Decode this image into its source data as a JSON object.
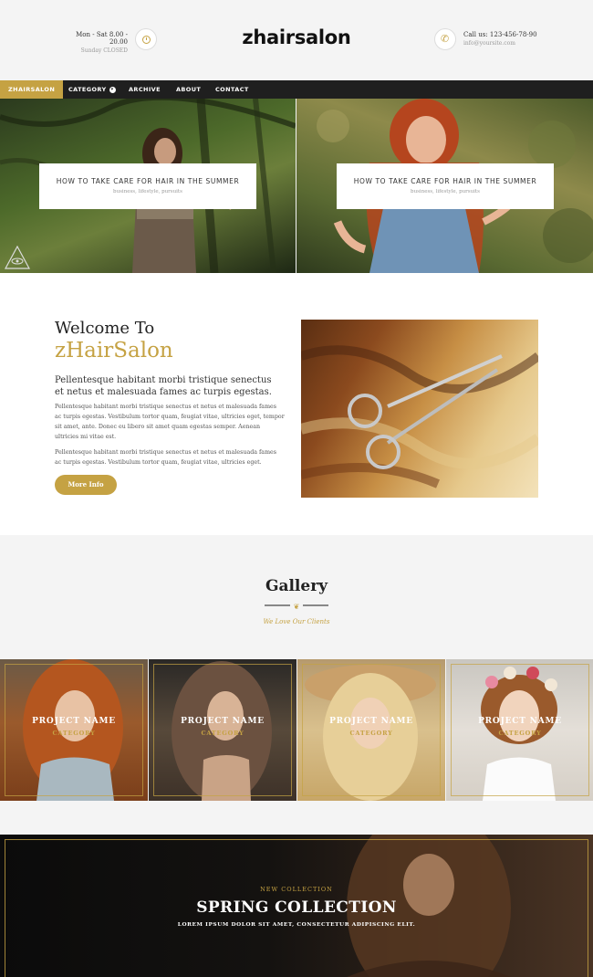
{
  "header": {
    "hours_line1": "Mon - Sat 8.00 - 20.00",
    "hours_line2": "Sunday CLOSED",
    "logo": "zhairsalon",
    "call_line1": "Call us: 123-456-78-90",
    "call_line2": "info@yoursite.com"
  },
  "nav": {
    "items": [
      {
        "label": "ZHAIRSALON"
      },
      {
        "label": "CATEGORY"
      },
      {
        "label": "ARCHIVE"
      },
      {
        "label": "ABOUT"
      },
      {
        "label": "CONTACT"
      }
    ]
  },
  "hero": [
    {
      "title": "HOW TO TAKE CARE FOR HAIR IN THE SUMMER",
      "meta": "business, lifestyle, pursuits"
    },
    {
      "title": "HOW TO TAKE CARE FOR HAIR IN THE SUMMER",
      "meta": "business, lifestyle, pursuits"
    }
  ],
  "welcome": {
    "title": "Welcome To",
    "brand": "zHairSalon",
    "lead": "Pellentesque habitant morbi tristique senectus et netus et malesuada fames ac turpis egestas.",
    "para1": "Pellentesque habitant morbi tristique senectus et netus et malesuada fames ac turpis egestas. Vestibulum tortor quam, feugiat vitae, ultricies eget, tempor sit amet, ante. Donec eu libero sit amet quam egestas semper. Aenean ultricies mi vitae est.",
    "para2": "Pellentesque habitant morbi tristique senectus et netus et malesuada fames ac turpis egestas. Vestibulum tortor quam, feugiat vitae, ultricies eget.",
    "button": "More Info"
  },
  "gallery": {
    "title": "Gallery",
    "subtitle": "We Love Our Clients",
    "ornament": "❦",
    "tiles": [
      {
        "name": "PROJECT NAME",
        "category": "CATEGORY"
      },
      {
        "name": "PROJECT NAME",
        "category": "CATEGORY"
      },
      {
        "name": "PROJECT NAME",
        "category": "CATEGORY"
      },
      {
        "name": "PROJECT NAME",
        "category": "CATEGORY"
      }
    ]
  },
  "collection": {
    "kicker": "NEW COLLECTION",
    "title": "SPRING COLLECTION",
    "subtitle": "LOREM IPSUM DOLOR SIT AMET, CONSECTETUR ADIPISCING ELIT."
  },
  "colors": {
    "accent": "#c5a243",
    "nav_bg": "#1f1f1f",
    "page_bg": "#f4f4f4"
  },
  "icons": {
    "hours": "clock-icon",
    "call": "phone-icon",
    "menu_caret": "chevron-down-icon"
  }
}
